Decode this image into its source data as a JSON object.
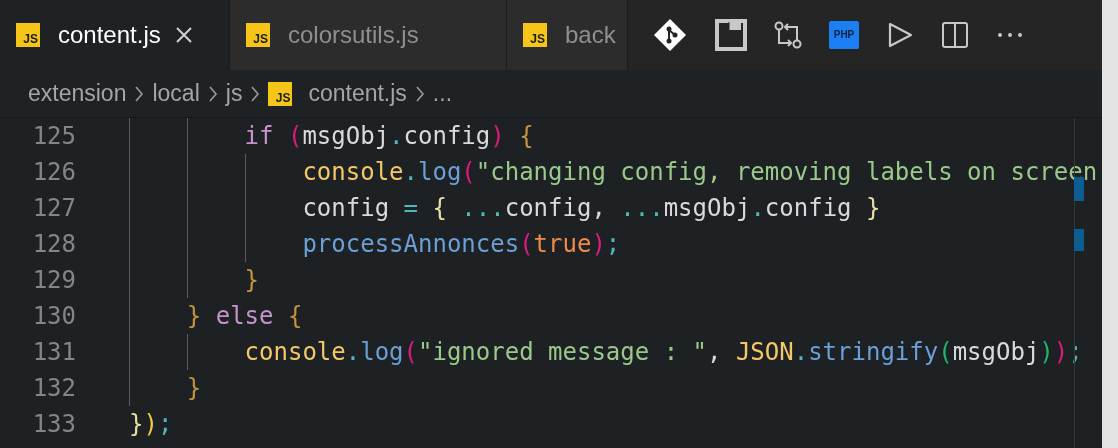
{
  "tabs": [
    {
      "label": "content.js",
      "icon_text": "JS",
      "selected": true,
      "closable": true
    },
    {
      "label": "colorsutils.js",
      "icon_text": "JS",
      "selected": false,
      "closable": false
    },
    {
      "label": "back",
      "icon_text": "JS",
      "selected": false,
      "closable": false
    }
  ],
  "toolbar": [
    {
      "kind": "git"
    },
    {
      "kind": "square"
    },
    {
      "kind": "compare"
    },
    {
      "kind": "php",
      "text": "PHP"
    },
    {
      "kind": "run"
    },
    {
      "kind": "split"
    },
    {
      "kind": "more"
    }
  ],
  "breadcrumbs": [
    {
      "label": "extension"
    },
    {
      "label": "local"
    },
    {
      "label": "js"
    },
    {
      "label": "content.js",
      "icon_text": "JS"
    },
    {
      "label": "..."
    }
  ],
  "code": {
    "lines": [
      {
        "number": "125",
        "tokens": [
          {
            "kind": "keyword",
            "text": "        if "
          },
          {
            "kind": "paren",
            "text": "("
          },
          {
            "kind": "variable",
            "text": "msgObj"
          },
          {
            "kind": "operator",
            "text": "."
          },
          {
            "kind": "variable",
            "text": "config"
          },
          {
            "kind": "paren",
            "text": ")"
          },
          {
            "kind": "brace",
            "text": " {"
          }
        ]
      },
      {
        "number": "126",
        "tokens": [
          {
            "kind": "object",
            "text": "            console"
          },
          {
            "kind": "operator",
            "text": "."
          },
          {
            "kind": "function",
            "text": "log"
          },
          {
            "kind": "paren",
            "text": "("
          },
          {
            "kind": "string",
            "text": "\"changing config, removing labels on screen"
          }
        ]
      },
      {
        "number": "127",
        "tokens": [
          {
            "kind": "variable",
            "text": "            config "
          },
          {
            "kind": "operator",
            "text": "="
          },
          {
            "kind": "spread",
            "text": " { "
          },
          {
            "kind": "operator",
            "text": "..."
          },
          {
            "kind": "variable",
            "text": "config, "
          },
          {
            "kind": "operator",
            "text": "..."
          },
          {
            "kind": "variable",
            "text": "msgObj"
          },
          {
            "kind": "operator",
            "text": "."
          },
          {
            "kind": "variable",
            "text": "config"
          },
          {
            "kind": "spread",
            "text": " }"
          }
        ]
      },
      {
        "number": "128",
        "tokens": [
          {
            "kind": "function",
            "text": "            processAnnonces"
          },
          {
            "kind": "paren",
            "text": "("
          },
          {
            "kind": "boolean",
            "text": "true"
          },
          {
            "kind": "paren",
            "text": ")"
          },
          {
            "kind": "operator",
            "text": ";"
          }
        ]
      },
      {
        "number": "129",
        "tokens": [
          {
            "kind": "brace",
            "text": "        }"
          }
        ]
      },
      {
        "number": "130",
        "tokens": [
          {
            "kind": "brace",
            "text": "    } "
          },
          {
            "kind": "keyword",
            "text": "else"
          },
          {
            "kind": "brace",
            "text": " {"
          }
        ]
      },
      {
        "number": "131",
        "tokens": [
          {
            "kind": "object",
            "text": "        console"
          },
          {
            "kind": "operator",
            "text": "."
          },
          {
            "kind": "function",
            "text": "log"
          },
          {
            "kind": "paren",
            "text": "("
          },
          {
            "kind": "string",
            "text": "\"ignored message : \""
          },
          {
            "kind": "variable",
            "text": ", "
          },
          {
            "kind": "object",
            "text": "JSON"
          },
          {
            "kind": "operator",
            "text": "."
          },
          {
            "kind": "function",
            "text": "stringify"
          },
          {
            "kind": "inner_paren",
            "text": "("
          },
          {
            "kind": "variable",
            "text": "msgObj"
          },
          {
            "kind": "inner_paren",
            "text": ")"
          },
          {
            "kind": "paren",
            "text": ")"
          },
          {
            "kind": "operator",
            "text": ";"
          }
        ]
      },
      {
        "number": "132",
        "tokens": [
          {
            "kind": "brace",
            "text": "    }"
          }
        ]
      },
      {
        "number": "133",
        "tokens": [
          {
            "kind": "spread",
            "text": "}"
          },
          {
            "kind": "outer_paren",
            "text": ")"
          },
          {
            "kind": "operator",
            "text": ";"
          }
        ]
      }
    ]
  }
}
